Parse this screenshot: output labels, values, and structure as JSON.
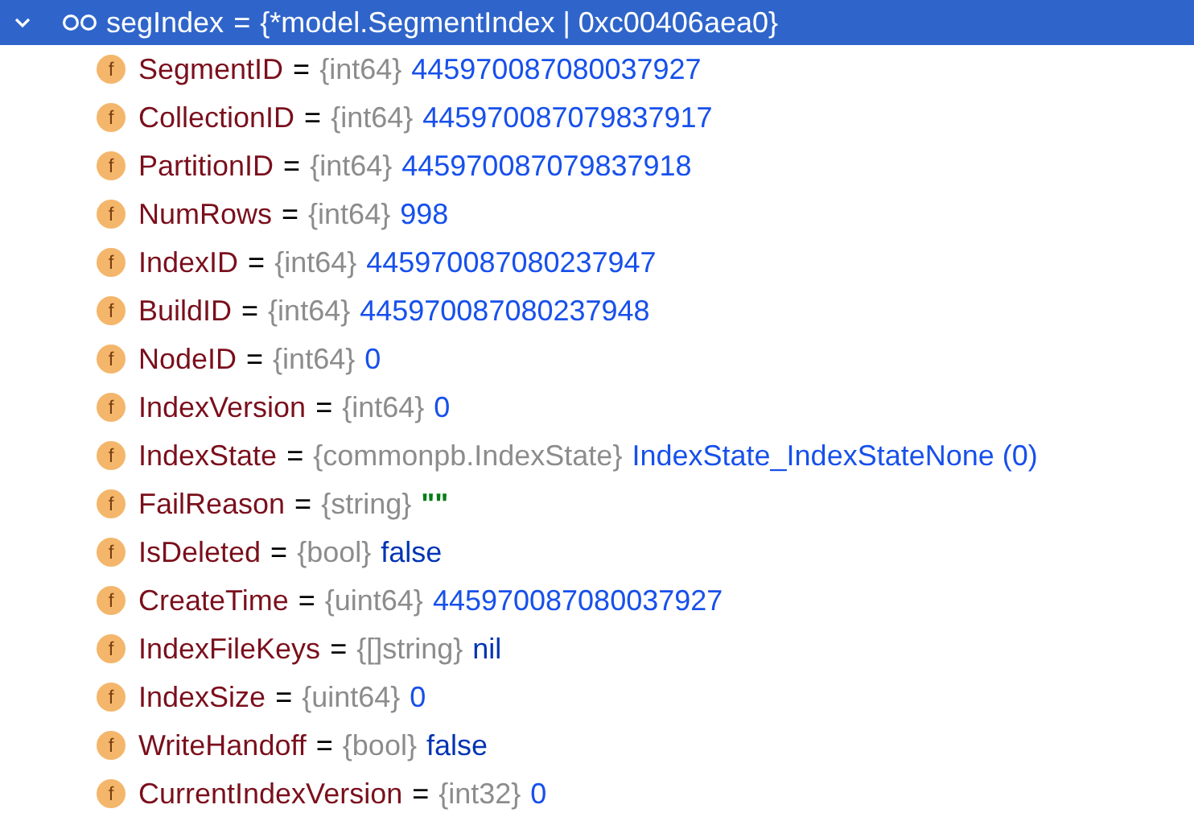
{
  "root": {
    "name": "segIndex",
    "separator": "=",
    "type": "{*model.SegmentIndex | 0xc00406aea0}",
    "selected": true,
    "expanded": true
  },
  "fields": [
    {
      "badge": "f",
      "name": "SegmentID",
      "separator": "=",
      "type": "{int64}",
      "value": "445970087080037927",
      "kind": "number"
    },
    {
      "badge": "f",
      "name": "CollectionID",
      "separator": "=",
      "type": "{int64}",
      "value": "445970087079837917",
      "kind": "number"
    },
    {
      "badge": "f",
      "name": "PartitionID",
      "separator": "=",
      "type": "{int64}",
      "value": "445970087079837918",
      "kind": "number"
    },
    {
      "badge": "f",
      "name": "NumRows",
      "separator": "=",
      "type": "{int64}",
      "value": "998",
      "kind": "number"
    },
    {
      "badge": "f",
      "name": "IndexID",
      "separator": "=",
      "type": "{int64}",
      "value": "445970087080237947",
      "kind": "number"
    },
    {
      "badge": "f",
      "name": "BuildID",
      "separator": "=",
      "type": "{int64}",
      "value": "445970087080237948",
      "kind": "number"
    },
    {
      "badge": "f",
      "name": "NodeID",
      "separator": "=",
      "type": "{int64}",
      "value": "0",
      "kind": "number"
    },
    {
      "badge": "f",
      "name": "IndexVersion",
      "separator": "=",
      "type": "{int64}",
      "value": "0",
      "kind": "number"
    },
    {
      "badge": "f",
      "name": "IndexState",
      "separator": "=",
      "type": "{commonpb.IndexState}",
      "value": "IndexState_IndexStateNone (0)",
      "kind": "number"
    },
    {
      "badge": "f",
      "name": "FailReason",
      "separator": "=",
      "type": "{string}",
      "value": "\"\"",
      "kind": "string"
    },
    {
      "badge": "f",
      "name": "IsDeleted",
      "separator": "=",
      "type": "{bool}",
      "value": "false",
      "kind": "keyword"
    },
    {
      "badge": "f",
      "name": "CreateTime",
      "separator": "=",
      "type": "{uint64}",
      "value": "445970087080037927",
      "kind": "number"
    },
    {
      "badge": "f",
      "name": "IndexFileKeys",
      "separator": "=",
      "type": "{[]string}",
      "value": "nil",
      "kind": "keyword"
    },
    {
      "badge": "f",
      "name": "IndexSize",
      "separator": "=",
      "type": "{uint64}",
      "value": "0",
      "kind": "number"
    },
    {
      "badge": "f",
      "name": "WriteHandoff",
      "separator": "=",
      "type": "{bool}",
      "value": "false",
      "kind": "keyword"
    },
    {
      "badge": "f",
      "name": "CurrentIndexVersion",
      "separator": "=",
      "type": "{int32}",
      "value": "0",
      "kind": "number"
    }
  ]
}
